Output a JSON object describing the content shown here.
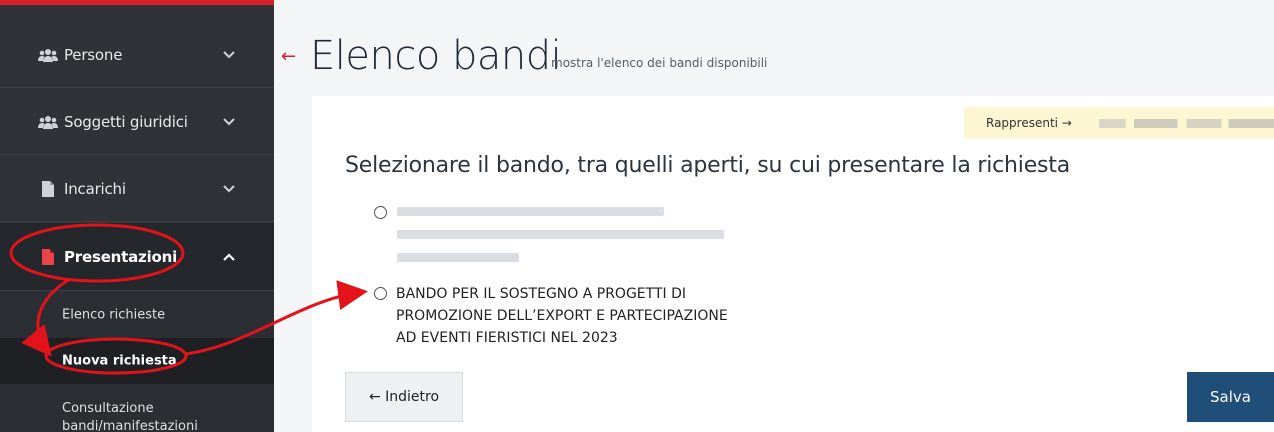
{
  "sidebar": {
    "items": [
      {
        "label": "Persone",
        "icon": "users-icon"
      },
      {
        "label": "Soggetti giuridici",
        "icon": "users-icon"
      },
      {
        "label": "Incarichi",
        "icon": "file-icon"
      },
      {
        "label": "Presentazioni",
        "icon": "file-icon"
      }
    ],
    "subitems": [
      {
        "label": "Elenco richieste"
      },
      {
        "label": "Nuova richiesta"
      },
      {
        "label": "Consultazione"
      },
      {
        "label": "bandi/manifestazioni"
      }
    ]
  },
  "header": {
    "back_arrow": "←",
    "title": "Elenco bandi",
    "subtitle": "mostra l'elenco dei bandi disponibili"
  },
  "represents": {
    "label": "Rappresenti →"
  },
  "main": {
    "instruction": "Selezionare il bando, tra quelli aperti, su cui presentare la richiesta",
    "bando2": {
      "line1": "BANDO PER IL SOSTEGNO A PROGETTI DI",
      "line2": "PROMOZIONE DELL’EXPORT E PARTECIPAZIONE",
      "line3": "AD EVENTI FIERISTICI NEL 2023"
    }
  },
  "buttons": {
    "back": "← Indietro",
    "save": "Salva"
  },
  "colors": {
    "sidebar_bg": "#2f3338",
    "accent_red": "#d6212a",
    "annotation_red": "#e3131b",
    "save_bg": "#1f4e79",
    "represents_bg": "#fdf6d2"
  }
}
